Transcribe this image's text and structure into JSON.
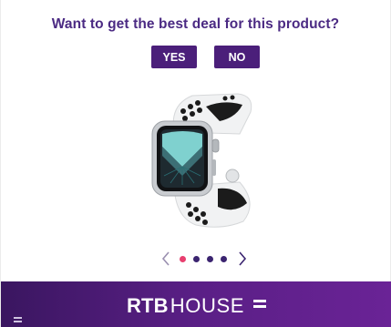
{
  "prompt": {
    "question": "Want to get the best deal for this product?",
    "yes_label": "YES",
    "no_label": "NO"
  },
  "product": {
    "image_icon": "smartwatch-icon"
  },
  "carousel": {
    "dot_count": 4,
    "active_index": 0,
    "prev_icon": "chevron-left-icon",
    "next_icon": "chevron-right-icon"
  },
  "footer": {
    "brand_bold": "RTB",
    "brand_light": "HOUSE",
    "brand_mark_icon": "equals-icon",
    "menu_icon": "menu-icon"
  },
  "colors": {
    "accent": "#4b1f7a",
    "question_text": "#4b2a83",
    "dot_active": "#e83f6f",
    "dot_inactive": "#3b2470",
    "footer_start": "#3a1660",
    "footer_end": "#6a2396"
  }
}
